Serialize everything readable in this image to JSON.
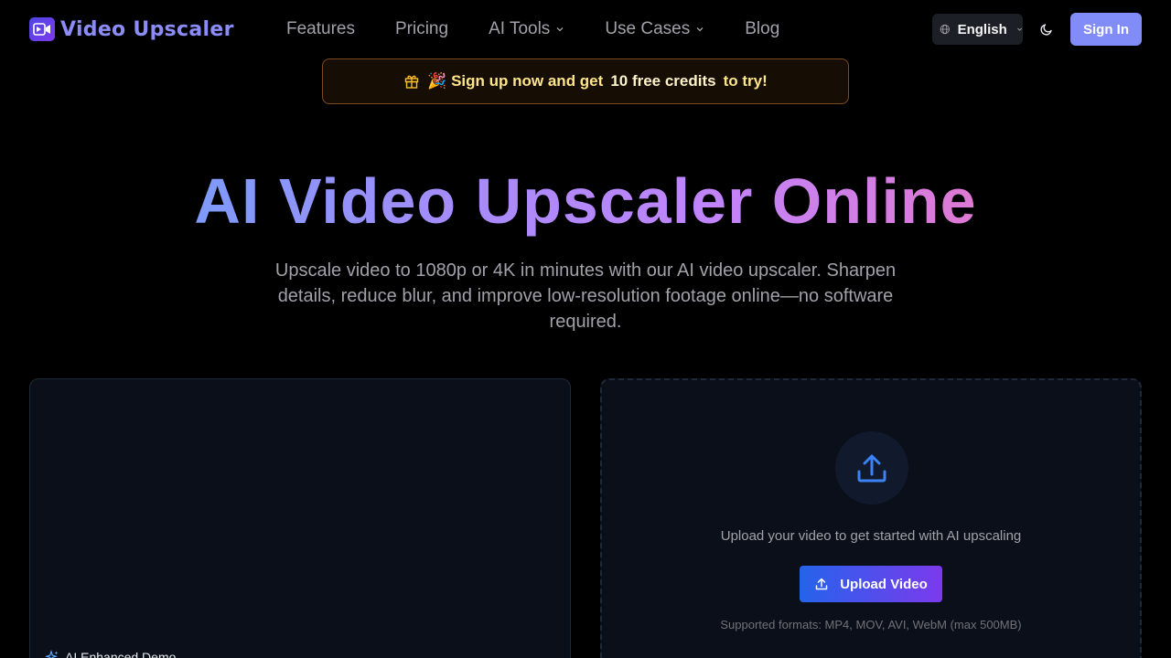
{
  "nav": {
    "logo_text": "Video Upscaler",
    "links": [
      {
        "label": "Features",
        "dropdown": false
      },
      {
        "label": "Pricing",
        "dropdown": false
      },
      {
        "label": "AI Tools",
        "dropdown": true
      },
      {
        "label": "Use Cases",
        "dropdown": true
      },
      {
        "label": "Blog",
        "dropdown": false
      }
    ],
    "language": "English",
    "sign_in_label": "Sign In"
  },
  "banner": {
    "prefix": "🎉 Sign up now and get",
    "highlight": "10 free credits",
    "suffix": "to try!"
  },
  "hero": {
    "title": "AI Video Upscaler Online",
    "subtitle": "Upscale video to 1080p or 4K in minutes with our AI video upscaler. Sharpen details, reduce blur, and improve low-resolution footage online—no software required."
  },
  "demo": {
    "label": "AI Enhanced Demo"
  },
  "upload": {
    "prompt": "Upload your video to get started with AI upscaling",
    "button_label": "Upload Video",
    "formats": "Supported formats: MP4, MOV, AVI, WebM (max 500MB)"
  },
  "colors": {
    "accent": "#818cf8",
    "banner_border": "#7c4a1e",
    "upload_gradient_start": "#2563eb",
    "upload_gradient_end": "#7c3aed"
  }
}
